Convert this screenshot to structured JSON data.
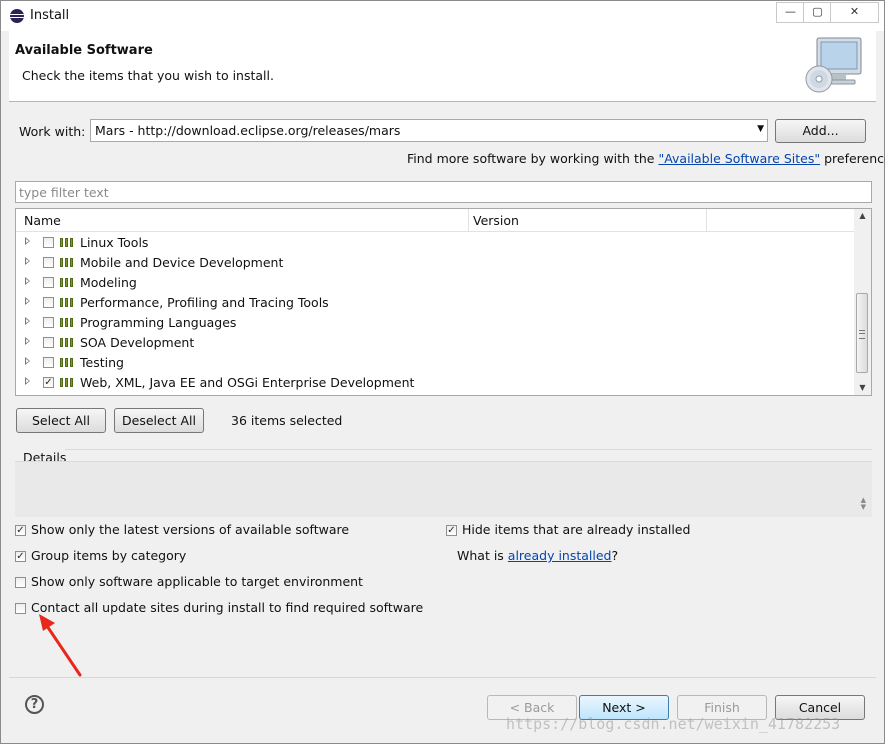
{
  "window": {
    "title": "Install",
    "min_glyph": "—",
    "max_glyph": "▢",
    "close_glyph": "✕"
  },
  "header": {
    "title": "Available Software",
    "description": "Check the items that you wish to install."
  },
  "work_with": {
    "label": "Work with:",
    "value": "Mars - http://download.eclipse.org/releases/mars",
    "add_button": "Add...",
    "hint_prefix": "Find more software by working with the",
    "hint_link": "\"Available Software Sites\"",
    "hint_suffix": "preferences."
  },
  "filter": {
    "placeholder": "type filter text"
  },
  "tree": {
    "columns": [
      "Name",
      "Version"
    ],
    "items": [
      {
        "label": "Linux Tools",
        "checked": false
      },
      {
        "label": "Mobile and Device Development",
        "checked": false
      },
      {
        "label": "Modeling",
        "checked": false
      },
      {
        "label": "Performance, Profiling and Tracing Tools",
        "checked": false
      },
      {
        "label": "Programming Languages",
        "checked": false
      },
      {
        "label": "SOA Development",
        "checked": false
      },
      {
        "label": "Testing",
        "checked": false
      },
      {
        "label": "Web, XML, Java EE and OSGi Enterprise Development",
        "checked": true
      }
    ]
  },
  "selection": {
    "select_all": "Select All",
    "deselect_all": "Deselect All",
    "count_text": "36 items selected"
  },
  "details": {
    "label": "Details"
  },
  "options": {
    "latest_versions": {
      "label": "Show only the latest versions of available software",
      "checked": true
    },
    "group_by_category": {
      "label": "Group items by category",
      "checked": true
    },
    "target_env": {
      "label": "Show only software applicable to target environment",
      "checked": false
    },
    "contact_sites": {
      "label": "Contact all update sites during install to find required software",
      "checked": false
    },
    "hide_installed": {
      "label": "Hide items that are already installed",
      "checked": true
    },
    "what_is_prefix": "What is",
    "what_is_link": "already installed",
    "what_is_suffix": "?"
  },
  "footer": {
    "help_glyph": "?",
    "back": "< Back",
    "next": "Next >",
    "finish": "Finish",
    "cancel": "Cancel"
  },
  "watermark": "https://blog.csdn.net/weixin_41782253",
  "colors": {
    "link": "#0645ad",
    "annotation_arrow": "#e8271d",
    "category_icon": "#7a9a2e"
  }
}
